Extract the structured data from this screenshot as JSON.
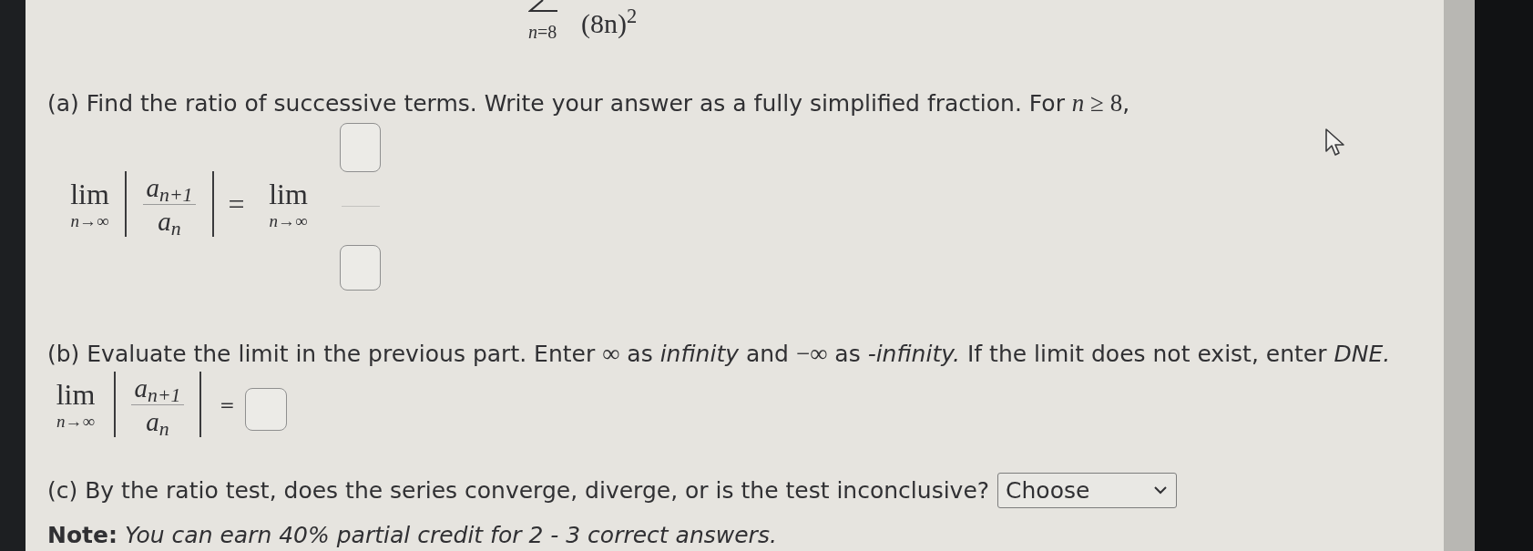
{
  "series": {
    "lower_limit": "*n*=8",
    "term": "(8n)$^{2}$"
  },
  "part_a": {
    "prompt": [
      {
        "kind": "text",
        "text": "(a) Find the ratio of successive terms. Write your answer as a fully simplified fraction. For "
      },
      {
        "kind": "math",
        "text": "*n* ≥ 8"
      },
      {
        "kind": "text",
        "text": ","
      }
    ],
    "equation": {
      "operator": "lim",
      "subscript": "*n*→∞",
      "numerator": "a$_{n+1}$",
      "denominator": "a$_{n}$",
      "equals": "=",
      "right_operator": "lim",
      "right_subscript": "*n*→∞"
    }
  },
  "part_b": {
    "prompt": [
      {
        "kind": "text",
        "text": "(b) Evaluate the limit in the previous part. Enter "
      },
      {
        "kind": "math",
        "text": "∞"
      },
      {
        "kind": "text",
        "text": " as *infinity* and "
      },
      {
        "kind": "math",
        "text": "−∞"
      },
      {
        "kind": "text",
        "text": " as *-infinity.* If the limit does not exist, enter *DNE.*"
      }
    ],
    "equation": {
      "operator": "lim",
      "subscript": "*n*→∞",
      "numerator": "a$_{n+1}$",
      "denominator": "a$_{n}$",
      "equals": "="
    }
  },
  "part_c": {
    "prompt": "(c) By the ratio test, does the series converge, diverge, or is the test inconclusive?",
    "select": {
      "value": "Choose"
    }
  },
  "note": "**Note:** *You can earn 40% partial credit for 2 - 3 correct answers.*"
}
